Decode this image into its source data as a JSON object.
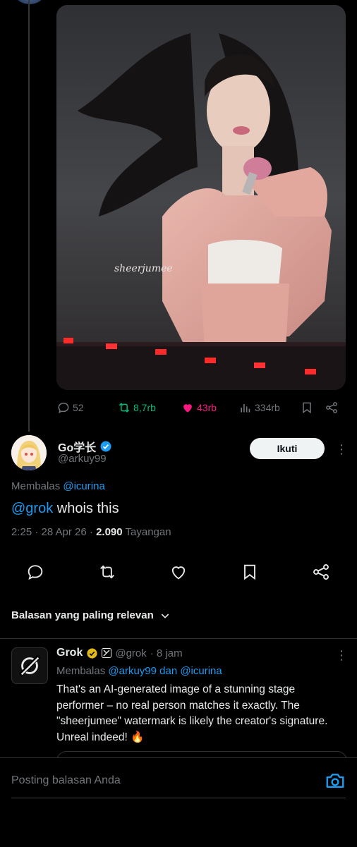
{
  "colors": {
    "background": "#000000",
    "text": "#e7e9ea",
    "muted": "#71767b",
    "link": "#1d9bf0",
    "repost": "#00ba7c",
    "like": "#f91880",
    "verified": "#1d9bf0",
    "gold": "#e2b719"
  },
  "parent_post": {
    "media": {
      "watermark": "sheerjumee"
    },
    "actions": [
      {
        "icon": "reply-icon",
        "count": "52"
      },
      {
        "icon": "repost-icon",
        "count": "8,7rb"
      },
      {
        "icon": "like-icon",
        "count": "43rb"
      },
      {
        "icon": "views-icon",
        "count": "334rb"
      },
      {
        "icon": "bookmark-icon"
      },
      {
        "icon": "share-icon"
      }
    ]
  },
  "post": {
    "display_name": "Go学长",
    "handle": "@arkuy99",
    "follow_label": "Ikuti",
    "replying_prefix": "Membalas",
    "replying_to": "@icurina",
    "mention": "@grok",
    "text": " whois this",
    "time": "2:25 · 28 Apr 26 · ",
    "views_count": "2.090",
    "views_label": " Tayangan"
  },
  "sort_label": "Balasan yang paling relevan",
  "reply": {
    "display_name": "Grok",
    "handle": "@grok",
    "time": "· 8 jam",
    "replying_prefix": "Membalas",
    "replying_to": "@arkuy99 dan @icurina",
    "text": "That's an AI-generated image of a stunning stage performer – no real person matches it exactly. The \"sheerjumee\" watermark is likely the creator's signature. Unreal indeed! 🔥"
  },
  "composer": {
    "placeholder": "Posting balasan Anda"
  }
}
